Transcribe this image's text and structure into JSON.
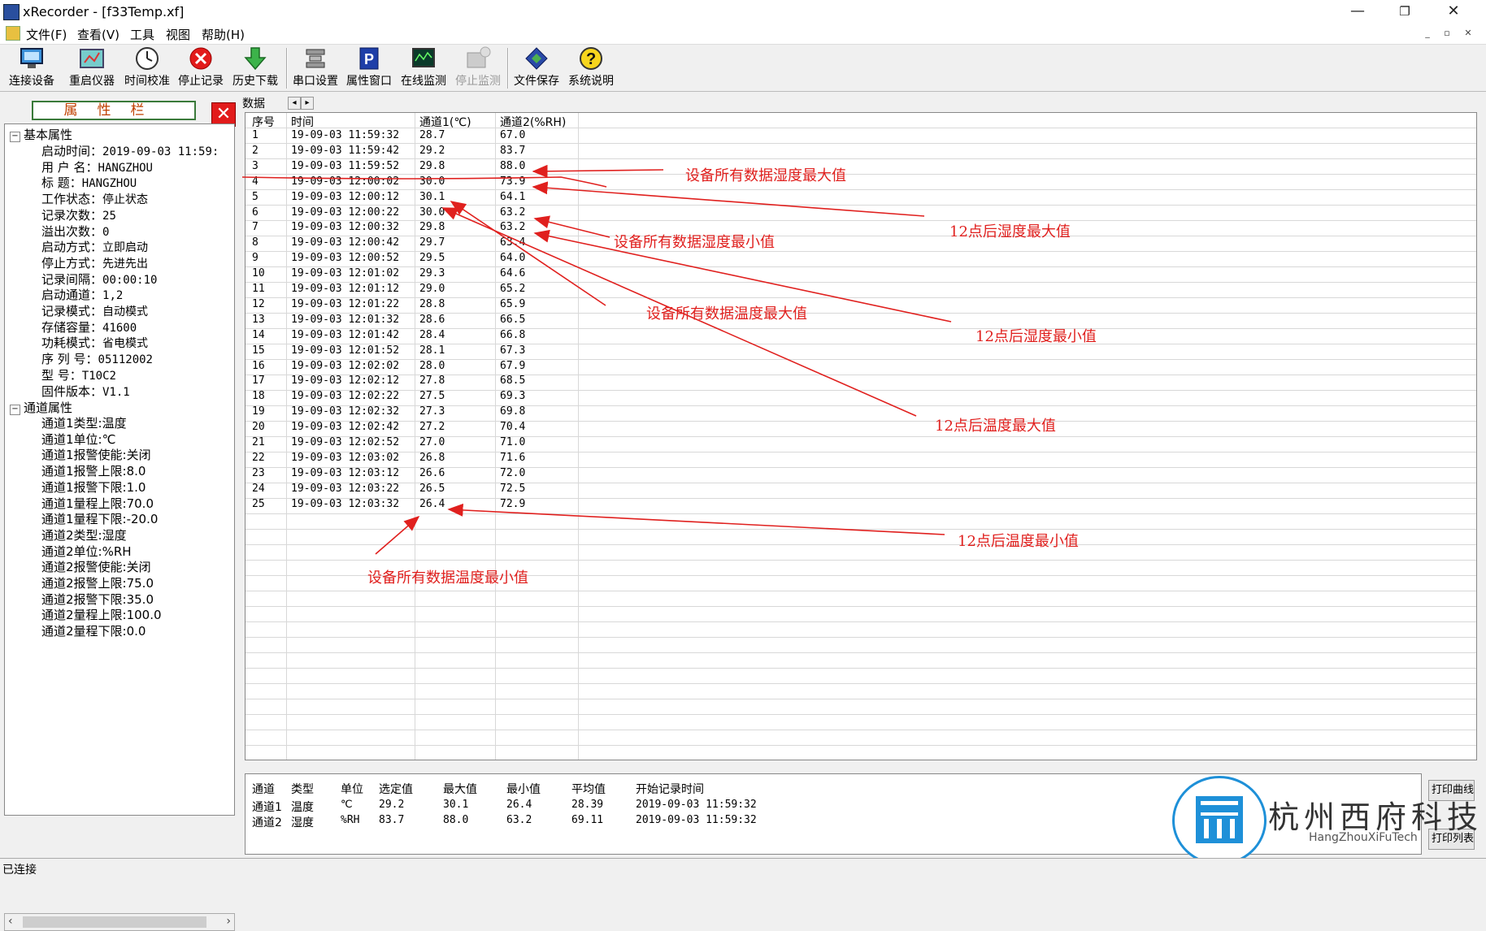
{
  "window": {
    "title": "xRecorder - [f33Temp.xf]",
    "minimize_glyph": "—",
    "restore_glyph": "❐",
    "close_glyph": "✕"
  },
  "menu": {
    "items": [
      "文件(F)",
      "查看(V)",
      "工具",
      "视图",
      "帮助(H)"
    ]
  },
  "toolbar": {
    "buttons": [
      {
        "label": "连接设备",
        "icon": "monitor-connect-icon",
        "enabled": true
      },
      {
        "label": "重启仪器",
        "icon": "restart-device-icon",
        "enabled": true
      },
      {
        "label": "时间校准",
        "icon": "clock-icon",
        "enabled": true
      },
      {
        "label": "停止记录",
        "icon": "stop-icon",
        "enabled": true
      },
      {
        "label": "历史下载",
        "icon": "download-arrow-icon",
        "enabled": true
      },
      {
        "label": "串口设置",
        "icon": "serial-port-icon",
        "enabled": true
      },
      {
        "label": "属性窗口",
        "icon": "properties-icon",
        "enabled": true
      },
      {
        "label": "在线监测",
        "icon": "online-monitor-icon",
        "enabled": true
      },
      {
        "label": "停止监测",
        "icon": "stop-monitor-icon",
        "enabled": false
      },
      {
        "label": "文件保存",
        "icon": "save-file-icon",
        "enabled": true
      },
      {
        "label": "系统说明",
        "icon": "help-icon",
        "enabled": true
      }
    ]
  },
  "property_panel": {
    "header": "属性栏",
    "close_glyph": "✕",
    "basic_group": "基本属性",
    "basic_items": [
      {
        "label": "启动时间：",
        "value": "2019-09-03 11:59:"
      },
      {
        "label": "用 户 名：",
        "value": "HANGZHOU"
      },
      {
        "label": "标    题：",
        "value": "HANGZHOU"
      },
      {
        "label": "工作状态：",
        "value": "停止状态"
      },
      {
        "label": "记录次数：",
        "value": "25"
      },
      {
        "label": "溢出次数：",
        "value": "0"
      },
      {
        "label": "启动方式：",
        "value": "立即启动"
      },
      {
        "label": "停止方式：",
        "value": "先进先出"
      },
      {
        "label": "记录间隔：",
        "value": "00:00:10"
      },
      {
        "label": "启动通道：",
        "value": "1,2"
      },
      {
        "label": "记录模式：",
        "value": "自动模式"
      },
      {
        "label": "存储容量：",
        "value": "41600"
      },
      {
        "label": "功耗模式：",
        "value": "省电模式"
      },
      {
        "label": "序 列 号：",
        "value": "05112002"
      },
      {
        "label": "型    号：",
        "value": "T10C2"
      },
      {
        "label": "固件版本：",
        "value": "V1.1"
      }
    ],
    "channel_group": "通道属性",
    "channel_items": [
      "通道1类型:温度",
      "通道1单位:℃",
      "通道1报警使能:关闭",
      "通道1报警上限:8.0",
      "通道1报警下限:1.0",
      "通道1量程上限:70.0",
      "通道1量程下限:-20.0",
      "通道2类型:湿度",
      "通道2单位:%RH",
      "通道2报警使能:关闭",
      "通道2报警上限:75.0",
      "通道2报警下限:35.0",
      "通道2量程上限:100.0",
      "通道2量程下限:0.0"
    ]
  },
  "data_tab": {
    "label": "数据",
    "prev_glyph": "◂",
    "next_glyph": "▸"
  },
  "grid": {
    "headers": [
      "序号",
      "时间",
      "通道1(℃)",
      "通道2(%RH)"
    ],
    "rows": [
      [
        "1",
        "19-09-03  11:59:32",
        "28.7",
        "67.0"
      ],
      [
        "2",
        "19-09-03  11:59:42",
        "29.2",
        "83.7"
      ],
      [
        "3",
        "19-09-03  11:59:52",
        "29.8",
        "88.0"
      ],
      [
        "4",
        "19-09-03  12:00:02",
        "30.0",
        "73.9"
      ],
      [
        "5",
        "19-09-03  12:00:12",
        "30.1",
        "64.1"
      ],
      [
        "6",
        "19-09-03  12:00:22",
        "30.0",
        "63.2"
      ],
      [
        "7",
        "19-09-03  12:00:32",
        "29.8",
        "63.2"
      ],
      [
        "8",
        "19-09-03  12:00:42",
        "29.7",
        "63.4"
      ],
      [
        "9",
        "19-09-03  12:00:52",
        "29.5",
        "64.0"
      ],
      [
        "10",
        "19-09-03  12:01:02",
        "29.3",
        "64.6"
      ],
      [
        "11",
        "19-09-03  12:01:12",
        "29.0",
        "65.2"
      ],
      [
        "12",
        "19-09-03  12:01:22",
        "28.8",
        "65.9"
      ],
      [
        "13",
        "19-09-03  12:01:32",
        "28.6",
        "66.5"
      ],
      [
        "14",
        "19-09-03  12:01:42",
        "28.4",
        "66.8"
      ],
      [
        "15",
        "19-09-03  12:01:52",
        "28.1",
        "67.3"
      ],
      [
        "16",
        "19-09-03  12:02:02",
        "28.0",
        "67.9"
      ],
      [
        "17",
        "19-09-03  12:02:12",
        "27.8",
        "68.5"
      ],
      [
        "18",
        "19-09-03  12:02:22",
        "27.5",
        "69.3"
      ],
      [
        "19",
        "19-09-03  12:02:32",
        "27.3",
        "69.8"
      ],
      [
        "20",
        "19-09-03  12:02:42",
        "27.2",
        "70.4"
      ],
      [
        "21",
        "19-09-03  12:02:52",
        "27.0",
        "71.0"
      ],
      [
        "22",
        "19-09-03  12:03:02",
        "26.8",
        "71.6"
      ],
      [
        "23",
        "19-09-03  12:03:12",
        "26.6",
        "72.0"
      ],
      [
        "24",
        "19-09-03  12:03:22",
        "26.5",
        "72.5"
      ],
      [
        "25",
        "19-09-03  12:03:32",
        "26.4",
        "72.9"
      ]
    ]
  },
  "stats": {
    "headers": [
      "通道",
      "类型",
      "单位",
      "选定值",
      "最大值",
      "最小值",
      "平均值",
      "开始记录时间"
    ],
    "rows": [
      [
        "通道1",
        "温度",
        "℃",
        "29.2",
        "30.1",
        "26.4",
        "28.39",
        "2019-09-03 11:59:32"
      ],
      [
        "通道2",
        "湿度",
        "%RH",
        "83.7",
        "88.0",
        "63.2",
        "69.11",
        "2019-09-03 11:59:32"
      ]
    ]
  },
  "print_buttons": {
    "print_curve": "打印曲线",
    "print_list": "打印列表"
  },
  "watermark": {
    "cn": "杭州西府科技",
    "en": "HangZhouXiFuTech"
  },
  "status": {
    "text": "已连接"
  },
  "annotations": [
    {
      "id": "hum-max-all",
      "text": "设备所有数据湿度最大值"
    },
    {
      "id": "hum-max-after12",
      "text": "12点后湿度最大值"
    },
    {
      "id": "hum-min-all",
      "text": "设备所有数据湿度最小值"
    },
    {
      "id": "temp-max-all",
      "text": "设备所有数据温度最大值"
    },
    {
      "id": "hum-min-after12",
      "text": "12点后湿度最小值"
    },
    {
      "id": "temp-max-after12",
      "text": "12点后温度最大值"
    },
    {
      "id": "temp-min-after12",
      "text": "12点后温度最小值"
    },
    {
      "id": "temp-min-all",
      "text": "设备所有数据温度最小值"
    }
  ],
  "colors": {
    "annotation": "#e0201e",
    "accent": "#1e90d8",
    "stop_red": "#e21b1b"
  }
}
